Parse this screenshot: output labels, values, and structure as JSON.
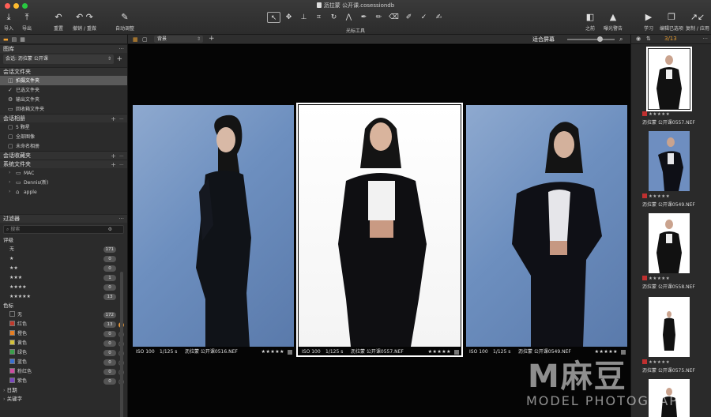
{
  "window": {
    "title": "沥拉蒙 公开课.cosessiondb"
  },
  "toolbar": {
    "import": "导入",
    "export": "导出",
    "reset": "重置",
    "undo_redo": "撤销 / 重做",
    "auto_adjust": "自动调整",
    "cursor_tools": "光标工具",
    "before": "之前",
    "exposure_warning": "曝光警告",
    "learn": "学习",
    "edit_selected": "编辑已选项",
    "copy_apply": "复制 / 应用"
  },
  "library": {
    "title": "图库",
    "session_label": "会话: 沥拉蒙 公开课",
    "session_folders": {
      "title": "会话文件夹",
      "items": [
        "拍摄文件夹",
        "已选文件夹",
        "输出文件夹",
        "回收箱文件夹"
      ]
    },
    "session_albums": {
      "title": "会话相册",
      "items": [
        "5 颗星",
        "全部图像",
        "未命名相册"
      ]
    },
    "session_favorites": {
      "title": "会话收藏夹"
    },
    "system_folders": {
      "title": "系统文件夹",
      "items": [
        "MAC",
        "Dennis(新)",
        "apple"
      ]
    }
  },
  "filters": {
    "title": "过滤器",
    "search_placeholder": "搜索",
    "rating": {
      "title": "评级",
      "rows": [
        {
          "label": "无",
          "count": "171"
        },
        {
          "label": "★",
          "count": "0"
        },
        {
          "label": "★★",
          "count": "0"
        },
        {
          "label": "★★★",
          "count": "1"
        },
        {
          "label": "★★★★",
          "count": "0"
        },
        {
          "label": "★★★★★",
          "count": "13"
        }
      ]
    },
    "color_tag": {
      "title": "色标",
      "rows": [
        {
          "label": "无",
          "count": "172",
          "color": "#2b2b2b"
        },
        {
          "label": "红色",
          "count": "13",
          "color": "#c0392b"
        },
        {
          "label": "橙色",
          "count": "0",
          "color": "#e67e22"
        },
        {
          "label": "黄色",
          "count": "0",
          "color": "#d4c23a"
        },
        {
          "label": "绿色",
          "count": "0",
          "color": "#3aa04a"
        },
        {
          "label": "蓝色",
          "count": "0",
          "color": "#3a6fd0"
        },
        {
          "label": "粉红色",
          "count": "0",
          "color": "#d04aa0"
        },
        {
          "label": "紫色",
          "count": "0",
          "color": "#7a44c0"
        }
      ]
    },
    "date": "日期",
    "keywords": "关键字"
  },
  "viewer": {
    "background": "背景",
    "fit": "适合屏幕",
    "captions": [
      {
        "iso": "ISO 100",
        "shutter": "1/125 s",
        "file": "沥拉蒙 公开课0516.NEF",
        "stars": "★★★★★"
      },
      {
        "iso": "ISO 100",
        "shutter": "1/125 s",
        "file": "沥拉蒙 公开课0557.NEF",
        "stars": "★★★★★"
      },
      {
        "iso": "ISO 100",
        "shutter": "1/125 s",
        "file": "沥拉蒙 公开课0549.NEF",
        "stars": "★★★★★"
      }
    ]
  },
  "filmstrip": {
    "count": "3/13",
    "items": [
      {
        "name": "沥拉蒙 公开课0557.NEF",
        "stars": "★★★★★"
      },
      {
        "name": "沥拉蒙 公开课0549.NEF",
        "stars": "★★★★★"
      },
      {
        "name": "沥拉蒙 公开课0558.NEF",
        "stars": "★★★★★"
      },
      {
        "name": "沥拉蒙 公开课0575.NEF",
        "stars": "★★★★★"
      }
    ]
  },
  "watermark": {
    "brand": "M麻豆",
    "sub": "MODEL PHOTOGRAPH"
  },
  "colors": {
    "accent": "#e39a30",
    "panel": "#2b2b2b",
    "blue_backdrop": "#6d8fbf"
  }
}
